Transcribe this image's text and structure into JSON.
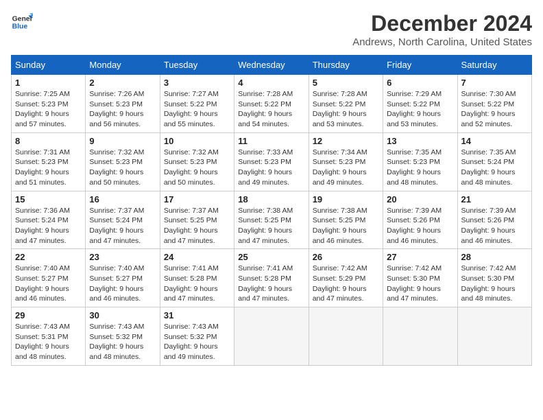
{
  "header": {
    "logo_line1": "General",
    "logo_line2": "Blue",
    "main_title": "December 2024",
    "subtitle": "Andrews, North Carolina, United States"
  },
  "calendar": {
    "days_of_week": [
      "Sunday",
      "Monday",
      "Tuesday",
      "Wednesday",
      "Thursday",
      "Friday",
      "Saturday"
    ],
    "weeks": [
      [
        {
          "day": "",
          "empty": true
        },
        {
          "day": "",
          "empty": true
        },
        {
          "day": "",
          "empty": true
        },
        {
          "day": "",
          "empty": true
        },
        {
          "day": "",
          "empty": true
        },
        {
          "day": "",
          "empty": true
        },
        {
          "day": "",
          "empty": true
        }
      ]
    ],
    "cells": [
      {
        "num": "1",
        "info": "Sunrise: 7:25 AM\nSunset: 5:23 PM\nDaylight: 9 hours\nand 57 minutes."
      },
      {
        "num": "2",
        "info": "Sunrise: 7:26 AM\nSunset: 5:23 PM\nDaylight: 9 hours\nand 56 minutes."
      },
      {
        "num": "3",
        "info": "Sunrise: 7:27 AM\nSunset: 5:22 PM\nDaylight: 9 hours\nand 55 minutes."
      },
      {
        "num": "4",
        "info": "Sunrise: 7:28 AM\nSunset: 5:22 PM\nDaylight: 9 hours\nand 54 minutes."
      },
      {
        "num": "5",
        "info": "Sunrise: 7:28 AM\nSunset: 5:22 PM\nDaylight: 9 hours\nand 53 minutes."
      },
      {
        "num": "6",
        "info": "Sunrise: 7:29 AM\nSunset: 5:22 PM\nDaylight: 9 hours\nand 53 minutes."
      },
      {
        "num": "7",
        "info": "Sunrise: 7:30 AM\nSunset: 5:22 PM\nDaylight: 9 hours\nand 52 minutes."
      },
      {
        "num": "8",
        "info": "Sunrise: 7:31 AM\nSunset: 5:23 PM\nDaylight: 9 hours\nand 51 minutes."
      },
      {
        "num": "9",
        "info": "Sunrise: 7:32 AM\nSunset: 5:23 PM\nDaylight: 9 hours\nand 50 minutes."
      },
      {
        "num": "10",
        "info": "Sunrise: 7:32 AM\nSunset: 5:23 PM\nDaylight: 9 hours\nand 50 minutes."
      },
      {
        "num": "11",
        "info": "Sunrise: 7:33 AM\nSunset: 5:23 PM\nDaylight: 9 hours\nand 49 minutes."
      },
      {
        "num": "12",
        "info": "Sunrise: 7:34 AM\nSunset: 5:23 PM\nDaylight: 9 hours\nand 49 minutes."
      },
      {
        "num": "13",
        "info": "Sunrise: 7:35 AM\nSunset: 5:23 PM\nDaylight: 9 hours\nand 48 minutes."
      },
      {
        "num": "14",
        "info": "Sunrise: 7:35 AM\nSunset: 5:24 PM\nDaylight: 9 hours\nand 48 minutes."
      },
      {
        "num": "15",
        "info": "Sunrise: 7:36 AM\nSunset: 5:24 PM\nDaylight: 9 hours\nand 47 minutes."
      },
      {
        "num": "16",
        "info": "Sunrise: 7:37 AM\nSunset: 5:24 PM\nDaylight: 9 hours\nand 47 minutes."
      },
      {
        "num": "17",
        "info": "Sunrise: 7:37 AM\nSunset: 5:25 PM\nDaylight: 9 hours\nand 47 minutes."
      },
      {
        "num": "18",
        "info": "Sunrise: 7:38 AM\nSunset: 5:25 PM\nDaylight: 9 hours\nand 47 minutes."
      },
      {
        "num": "19",
        "info": "Sunrise: 7:38 AM\nSunset: 5:25 PM\nDaylight: 9 hours\nand 46 minutes."
      },
      {
        "num": "20",
        "info": "Sunrise: 7:39 AM\nSunset: 5:26 PM\nDaylight: 9 hours\nand 46 minutes."
      },
      {
        "num": "21",
        "info": "Sunrise: 7:39 AM\nSunset: 5:26 PM\nDaylight: 9 hours\nand 46 minutes."
      },
      {
        "num": "22",
        "info": "Sunrise: 7:40 AM\nSunset: 5:27 PM\nDaylight: 9 hours\nand 46 minutes."
      },
      {
        "num": "23",
        "info": "Sunrise: 7:40 AM\nSunset: 5:27 PM\nDaylight: 9 hours\nand 46 minutes."
      },
      {
        "num": "24",
        "info": "Sunrise: 7:41 AM\nSunset: 5:28 PM\nDaylight: 9 hours\nand 47 minutes."
      },
      {
        "num": "25",
        "info": "Sunrise: 7:41 AM\nSunset: 5:28 PM\nDaylight: 9 hours\nand 47 minutes."
      },
      {
        "num": "26",
        "info": "Sunrise: 7:42 AM\nSunset: 5:29 PM\nDaylight: 9 hours\nand 47 minutes."
      },
      {
        "num": "27",
        "info": "Sunrise: 7:42 AM\nSunset: 5:30 PM\nDaylight: 9 hours\nand 47 minutes."
      },
      {
        "num": "28",
        "info": "Sunrise: 7:42 AM\nSunset: 5:30 PM\nDaylight: 9 hours\nand 48 minutes."
      },
      {
        "num": "29",
        "info": "Sunrise: 7:43 AM\nSunset: 5:31 PM\nDaylight: 9 hours\nand 48 minutes."
      },
      {
        "num": "30",
        "info": "Sunrise: 7:43 AM\nSunset: 5:32 PM\nDaylight: 9 hours\nand 48 minutes."
      },
      {
        "num": "31",
        "info": "Sunrise: 7:43 AM\nSunset: 5:32 PM\nDaylight: 9 hours\nand 49 minutes."
      }
    ]
  }
}
